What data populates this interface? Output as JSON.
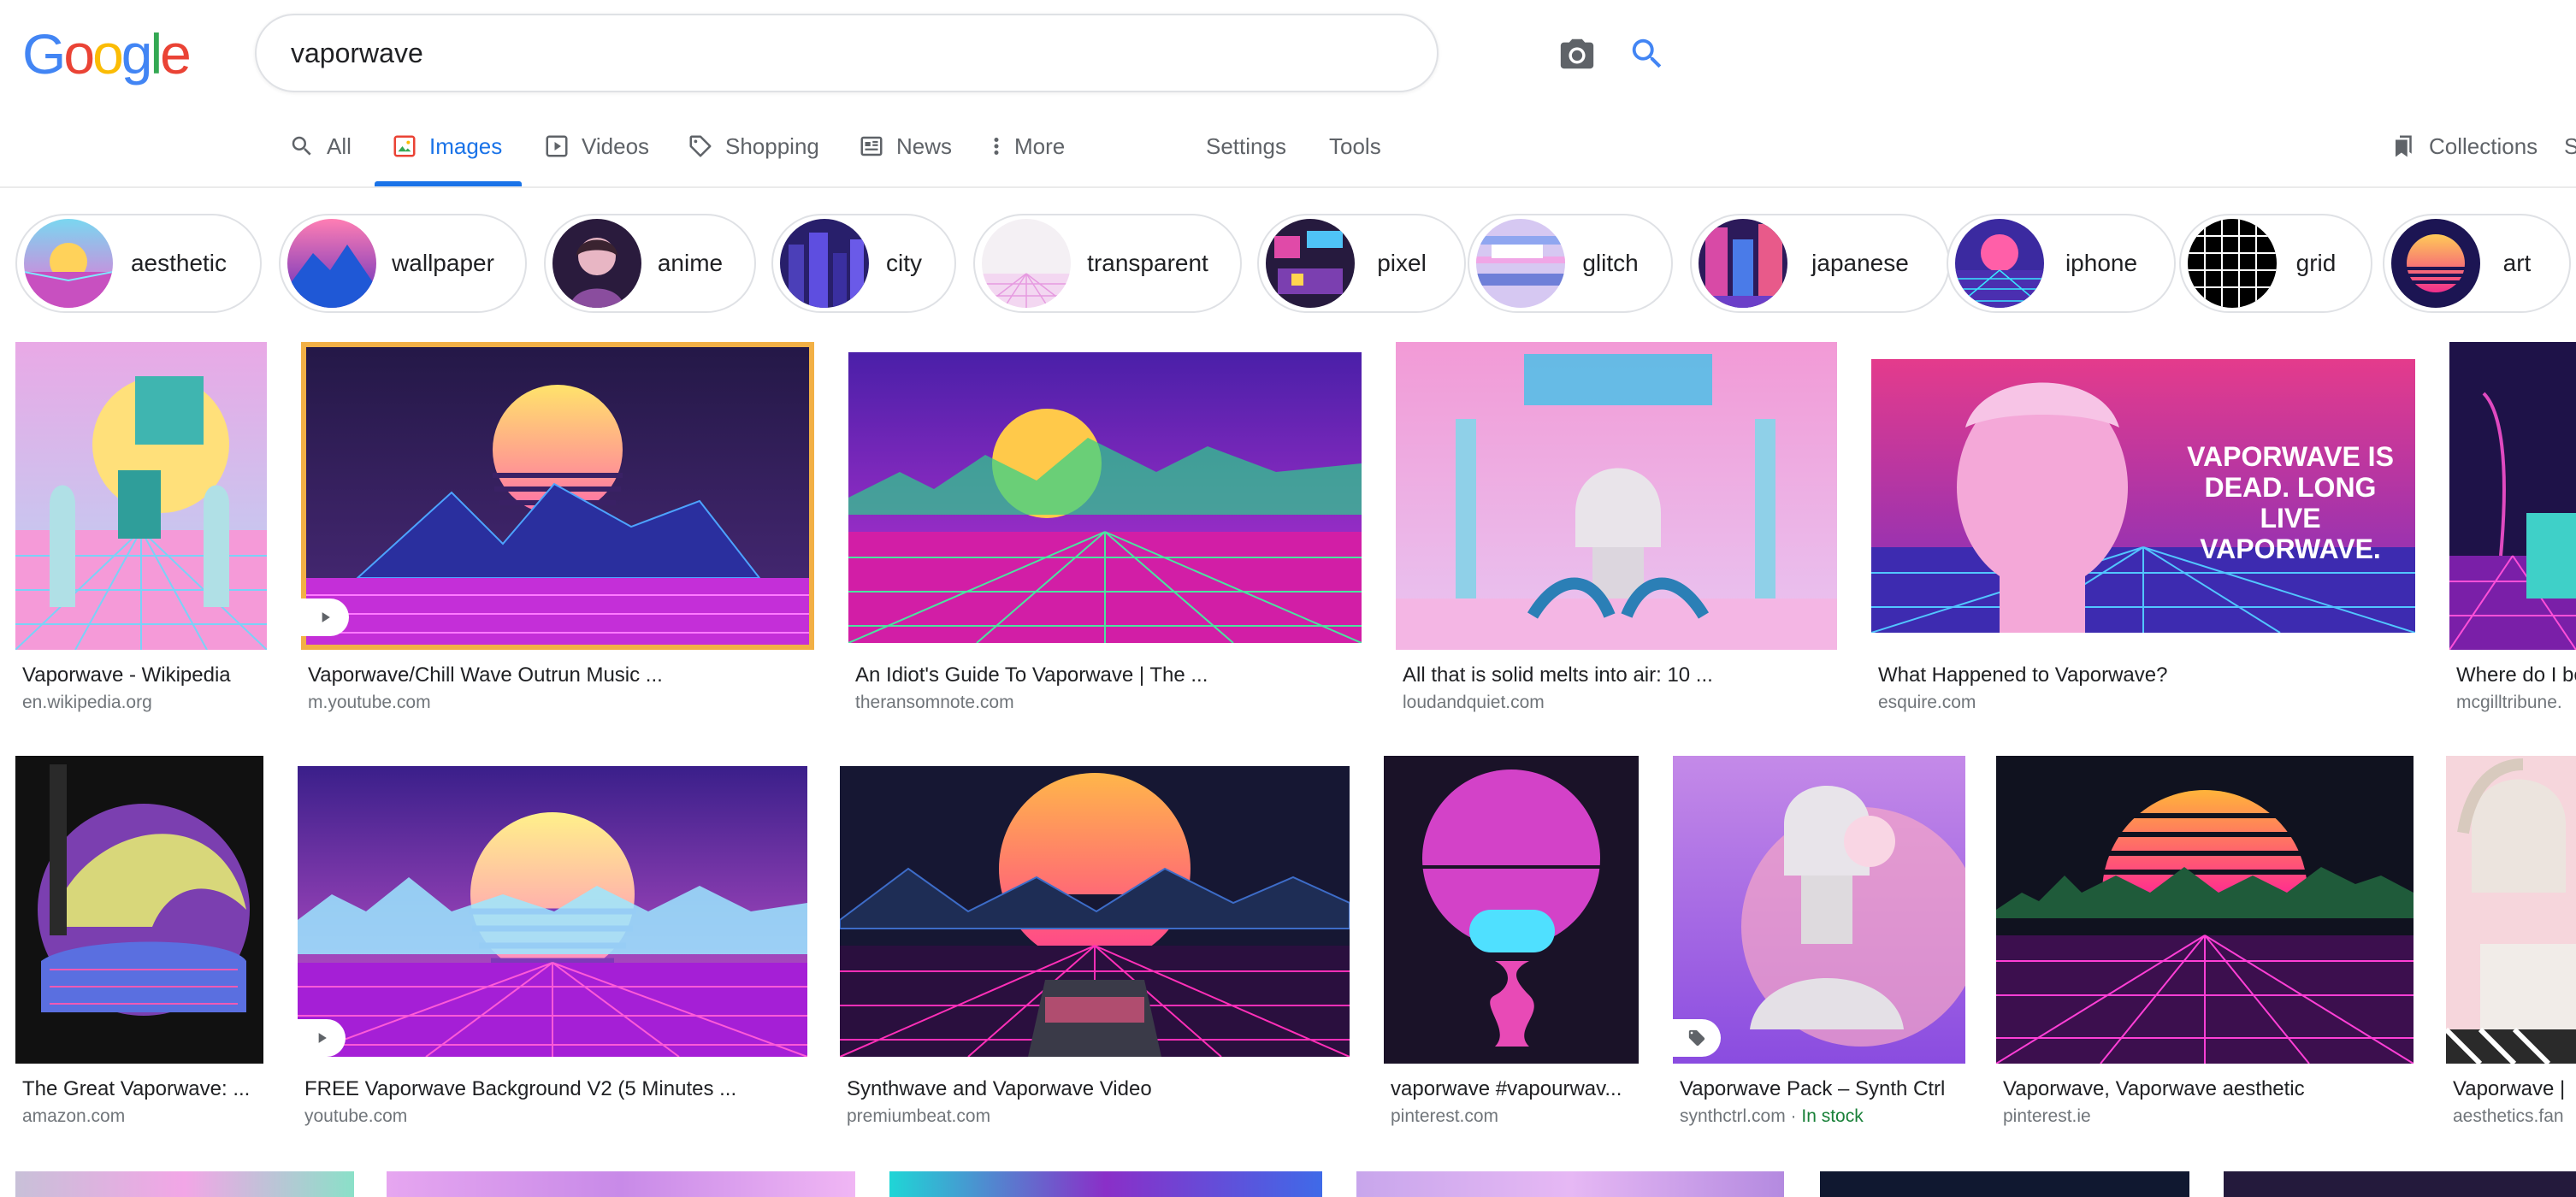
{
  "search": {
    "query": "vaporwave"
  },
  "logo": {
    "letters": [
      "G",
      "o",
      "o",
      "g",
      "l",
      "e"
    ]
  },
  "tabs": [
    {
      "label": "All",
      "icon": "search-icon"
    },
    {
      "label": "Images",
      "icon": "image-icon",
      "active": true
    },
    {
      "label": "Videos",
      "icon": "video-icon"
    },
    {
      "label": "Shopping",
      "icon": "tag-icon"
    },
    {
      "label": "News",
      "icon": "news-icon"
    },
    {
      "label": "More",
      "icon": "more-vert-icon"
    },
    {
      "label": "Settings"
    },
    {
      "label": "Tools"
    },
    {
      "label": "Collections",
      "icon": "bookmark-icon"
    },
    {
      "label": "S"
    }
  ],
  "chips": [
    {
      "label": "aesthetic"
    },
    {
      "label": "wallpaper"
    },
    {
      "label": "anime"
    },
    {
      "label": "city"
    },
    {
      "label": "transparent"
    },
    {
      "label": "pixel"
    },
    {
      "label": "glitch"
    },
    {
      "label": "japanese"
    },
    {
      "label": "iphone"
    },
    {
      "label": "grid"
    },
    {
      "label": "art"
    }
  ],
  "results": [
    {
      "title": "Vaporwave - Wikipedia",
      "source": "en.wikipedia.org"
    },
    {
      "title": "Vaporwave/Chill Wave Outrun Music ...",
      "source": "m.youtube.com",
      "badge": "play"
    },
    {
      "title": "An Idiot's Guide To Vaporwave | The ...",
      "source": "theransomnote.com"
    },
    {
      "title": "All that is solid melts into air: 10 ...",
      "source": "loudandquiet.com"
    },
    {
      "title": "What Happened to Vaporwave?",
      "source": "esquire.com",
      "image_text": "VAPORWAVE IS DEAD. LONG LIVE VAPORWAVE."
    },
    {
      "title": "Where do I be",
      "source": "mcgilltribune."
    },
    {
      "title": "The Great Vaporwave: ...",
      "source": "amazon.com"
    },
    {
      "title": "FREE Vaporwave Background V2 (5 Minutes ...",
      "source": "youtube.com",
      "badge": "play"
    },
    {
      "title": "Synthwave and Vaporwave Video",
      "source": "premiumbeat.com"
    },
    {
      "title": "vaporwave #vapourwav...",
      "source": "pinterest.com"
    },
    {
      "title": "Vaporwave Pack – Synth Ctrl",
      "source": "synthctrl.com",
      "stock": "In stock",
      "badge": "tag"
    },
    {
      "title": "Vaporwave, Vaporwave aesthetic",
      "source": "pinterest.ie"
    },
    {
      "title": "Vaporwave |",
      "source": "aesthetics.fan"
    }
  ],
  "colors": {
    "accent": "#1a73e8",
    "logo": [
      "#4285f4",
      "#ea4335",
      "#fbbc05",
      "#4285f4",
      "#34a853",
      "#ea4335"
    ]
  }
}
